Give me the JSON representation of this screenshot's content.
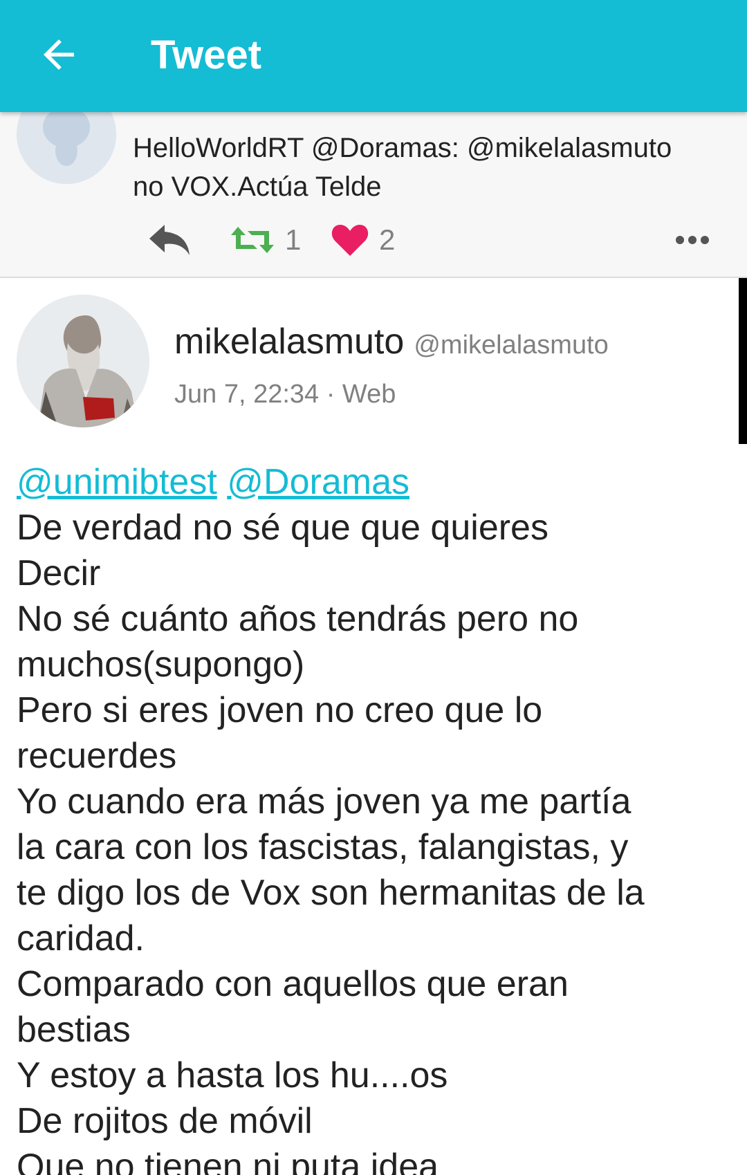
{
  "appbar": {
    "title": "Tweet",
    "back_icon": "arrow-back-icon"
  },
  "previous_tweet": {
    "text_line1": "HelloWorldRT @Doramas: @mikelalasmuto",
    "text_line2": "no VOX.Actúa Telde",
    "retweet_count": "1",
    "like_count": "2",
    "icons": [
      "reply-icon",
      "retweet-icon",
      "heart-icon",
      "more-icon"
    ],
    "colors": {
      "retweet": "#4caf50",
      "like": "#e91e63"
    }
  },
  "tweet": {
    "display_name": "mikelalasmuto",
    "handle": "@mikelalasmuto",
    "meta": "Jun 7, 22:34 · Web",
    "mentions": [
      "@unimibtest",
      "@Doramas"
    ],
    "lines": [
      "De verdad no sé que que quieres",
      "Decir",
      "No sé cuánto años tendrás pero no",
      "muchos(supongo)",
      "Pero si eres joven no creo que lo",
      "recuerdes",
      "Yo cuando era más joven ya me partía",
      "la cara con los fascistas, falangistas, y",
      "te digo los de Vox son hermanitas de la",
      "caridad.",
      "Comparado con aquellos que eran",
      "bestias",
      "Y estoy a hasta los hu....os",
      "De rojitos de móvil",
      "Que no tienen ni puta idea"
    ]
  },
  "theme": {
    "accent": "#14bcd4"
  }
}
